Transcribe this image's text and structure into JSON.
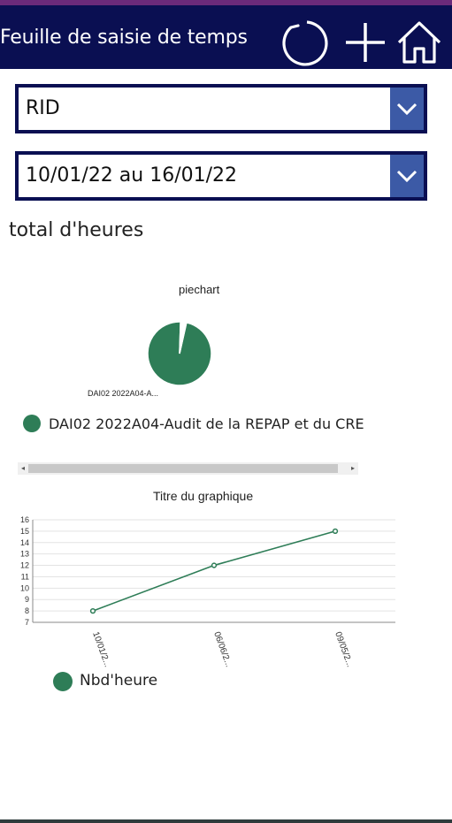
{
  "header": {
    "title": "Feuille de saisie de temps",
    "icons": [
      "refresh-icon",
      "add-icon",
      "home-icon"
    ],
    "background": "#0a0f52"
  },
  "dropdowns": {
    "project": {
      "value": "RID"
    },
    "period": {
      "value": "10/01/22 au 16/01/22"
    }
  },
  "section_label": "total d'heures",
  "pie": {
    "title": "piechart",
    "slice_label": "DAI02 2022A04-A...",
    "legend_label": "DAI02 2022A04-Audit de la REPAP et du CRE"
  },
  "line": {
    "title": "Titre du graphique",
    "legend_label": "Nbd'heure"
  },
  "colors": {
    "series": "#2e7d57",
    "dropdown_button": "#3c5aa6"
  },
  "chart_data": [
    {
      "type": "pie",
      "title": "piechart",
      "labels": [
        "DAI02 2022A04-Audit de la REPAP et du CRE",
        ""
      ],
      "values": [
        97,
        3
      ]
    },
    {
      "type": "line",
      "title": "Titre du graphique",
      "categories": [
        "10/01/2...",
        "06/06/2...",
        "09/05/2..."
      ],
      "series": [
        {
          "name": "Nbd'heure",
          "values": [
            8,
            12,
            15
          ]
        }
      ],
      "ylim": [
        7,
        16
      ],
      "yticks": [
        7,
        8,
        9,
        10,
        11,
        12,
        13,
        14,
        15,
        16
      ],
      "grid": true,
      "legend": "bottom-left"
    }
  ]
}
